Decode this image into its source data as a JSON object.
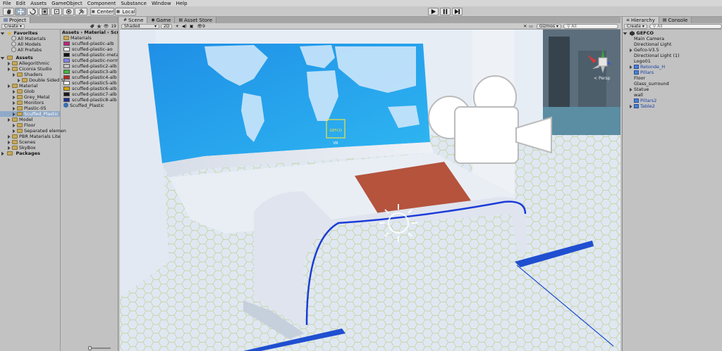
{
  "menu": [
    "File",
    "Edit",
    "Assets",
    "GameObject",
    "Component",
    "Substance",
    "Window",
    "Help"
  ],
  "toolbar": {
    "center_label": "Center",
    "local_label": "Local"
  },
  "project_panel": {
    "tab": "Project",
    "create_label": "Create",
    "count": "19",
    "favorites": {
      "header": "Favorites",
      "items": [
        "All Materials",
        "All Models",
        "All Prefabs"
      ]
    },
    "assets": {
      "header": "Assets",
      "tree": [
        {
          "label": "Allegorithmic",
          "depth": 1
        },
        {
          "label": "Ciconia Studio",
          "depth": 1
        },
        {
          "label": "Shaders",
          "depth": 2
        },
        {
          "label": "Double Sided Sl",
          "depth": 3
        },
        {
          "label": "Material",
          "depth": 1
        },
        {
          "label": "Glob",
          "depth": 2
        },
        {
          "label": "Grey_Metal",
          "depth": 2
        },
        {
          "label": "Monitors",
          "depth": 2
        },
        {
          "label": "Plastic-05",
          "depth": 2
        },
        {
          "label": "Scuffed_Plastic",
          "depth": 2,
          "selected": true
        },
        {
          "label": "Model",
          "depth": 1
        },
        {
          "label": "Floor",
          "depth": 2
        },
        {
          "label": "Separated elemen",
          "depth": 2
        },
        {
          "label": "PBR Materials Lite",
          "depth": 1
        },
        {
          "label": "Scenes",
          "depth": 1
        },
        {
          "label": "SkyBox",
          "depth": 1
        }
      ]
    },
    "packages_header": "Packages",
    "breadcrumb": [
      "Assets",
      "Material",
      "Scuffed"
    ],
    "files": [
      {
        "name": "Materials",
        "color": "#ffffff"
      },
      {
        "name": "scuffed-plastic-alb",
        "color": "#c2247f"
      },
      {
        "name": "scuffed-plastic-ao",
        "color": "#f2f2f2"
      },
      {
        "name": "scuffed-plastic-metal",
        "color": "#111111"
      },
      {
        "name": "scuffed-plastic-normal",
        "color": "#8080ff"
      },
      {
        "name": "scuffed-plastic2-alb",
        "color": "#c7c7c7"
      },
      {
        "name": "scuffed-plastic3-alb",
        "color": "#3fb83f"
      },
      {
        "name": "scuffed-plastic4-alb",
        "color": "#b42a22"
      },
      {
        "name": "scuffed-plastic5-alb",
        "color": "#f5f5f5"
      },
      {
        "name": "scuffed-plastic6-alb",
        "color": "#d9a400"
      },
      {
        "name": "scuffed-plastic7-alb",
        "color": "#1a1a1a"
      },
      {
        "name": "scuffed-plastic8-alb",
        "color": "#1e2f8f"
      },
      {
        "name": "Scuffed_Plastic",
        "color": "#3a6fb0"
      }
    ]
  },
  "scene_panel": {
    "tabs": [
      "Scene",
      "Game",
      "Asset Store"
    ],
    "shading": "Shaded",
    "mode_2d": "2D",
    "fx_count": "9",
    "gizmos_label": "Gizmos",
    "search_placeholder": "All",
    "persp_label": "Persp",
    "logo_text": "GEFCO",
    "logo_sub": "VR"
  },
  "hierarchy_panel": {
    "tabs": [
      "Hierarchy",
      "Console"
    ],
    "create_label": "Create",
    "search_placeholder": "All",
    "scene_name": "GEFCO",
    "items": [
      {
        "label": "Main Camera",
        "prefab": false,
        "arrow": false
      },
      {
        "label": "Directional Light",
        "prefab": false,
        "arrow": false
      },
      {
        "label": "Gefco-V3.5",
        "prefab": false,
        "arrow": true
      },
      {
        "label": "Directional Light (1)",
        "prefab": false,
        "arrow": false
      },
      {
        "label": "Logo01",
        "prefab": false,
        "arrow": false
      },
      {
        "label": "Retonde_H",
        "prefab": true,
        "arrow": true
      },
      {
        "label": "Pillars",
        "prefab": true,
        "arrow": false
      },
      {
        "label": "Floor",
        "prefab": false,
        "arrow": false
      },
      {
        "label": "Glass_surround",
        "prefab": false,
        "arrow": false
      },
      {
        "label": "Statue",
        "prefab": false,
        "arrow": true
      },
      {
        "label": "wall",
        "prefab": false,
        "arrow": false
      },
      {
        "label": "Pillars2",
        "prefab": true,
        "arrow": false
      },
      {
        "label": "Table2",
        "prefab": true,
        "arrow": true
      }
    ]
  }
}
